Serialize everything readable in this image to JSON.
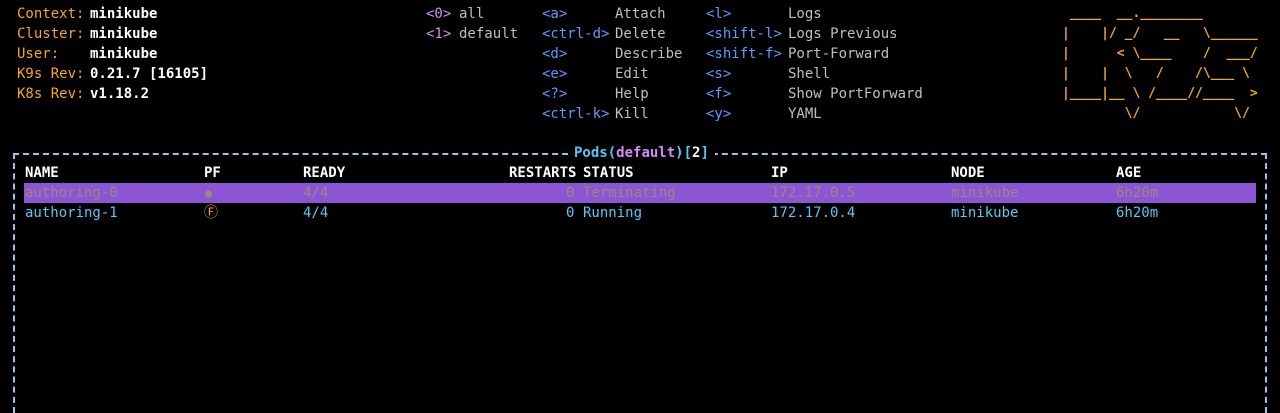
{
  "info": {
    "context_label": "Context:",
    "context_value": "minikube",
    "cluster_label": "Cluster:",
    "cluster_value": "minikube",
    "user_label": "User:",
    "user_value": "minikube",
    "k9s_rev_label": "K9s Rev:",
    "k9s_rev_value": "0.21.7 [16105]",
    "k8s_rev_label": "K8s Rev:",
    "k8s_rev_value": "v1.18.2"
  },
  "namespaces": [
    {
      "key": "<0>",
      "label": "all"
    },
    {
      "key": "<1>",
      "label": "default"
    }
  ],
  "shortcuts_col1": [
    {
      "key": "<a>",
      "label": "Attach"
    },
    {
      "key": "<ctrl-d>",
      "label": "Delete"
    },
    {
      "key": "<d>",
      "label": "Describe"
    },
    {
      "key": "<e>",
      "label": "Edit"
    },
    {
      "key": "<?>",
      "label": "Help"
    },
    {
      "key": "<ctrl-k>",
      "label": "Kill"
    }
  ],
  "shortcuts_col2": [
    {
      "key": "<l>",
      "label": "Logs"
    },
    {
      "key": "<shift-l>",
      "label": "Logs Previous"
    },
    {
      "key": "<shift-f>",
      "label": "Port-Forward"
    },
    {
      "key": "<s>",
      "label": "Shell"
    },
    {
      "key": "<f>",
      "label": "Show PortForward"
    },
    {
      "key": "<y>",
      "label": "YAML"
    }
  ],
  "logo_lines": [
    " ____  __.________       ",
    "|    |/ _/   __   \\______",
    "|      < \\____    /  ___/",
    "|    |  \\   /    /\\___ \\ ",
    "|____|__ \\ /____//____  >",
    "        \\/            \\/ "
  ],
  "table": {
    "title_resource": "Pods",
    "title_open": "(",
    "title_namespace": "default",
    "title_close": ")",
    "title_count_open": "[",
    "title_count": "2",
    "title_count_close": "]",
    "headers": {
      "name": "NAME",
      "pf": "PF",
      "ready": "READY",
      "restarts": "RESTARTS",
      "status": "STATUS",
      "ip": "IP",
      "node": "NODE",
      "age": "AGE"
    },
    "rows": [
      {
        "name": "authoring-0",
        "pf": "●",
        "ready": "4/4",
        "restarts": "0",
        "status": "Terminating",
        "ip": "172.17.0.5",
        "node": "minikube",
        "age": "6h20m"
      },
      {
        "name": "authoring-1",
        "pf": "Ⓕ",
        "ready": "4/4",
        "restarts": "0",
        "status": "Running",
        "ip": "172.17.0.4",
        "node": "minikube",
        "age": "6h20m"
      }
    ]
  },
  "colors": {
    "accent_orange": "#f5a623",
    "namespace_purple": "#d78af5",
    "shortcut_blue": "#5a9cff",
    "table_cyan": "#56c8f5",
    "selection_bg": "#8b55d6"
  }
}
